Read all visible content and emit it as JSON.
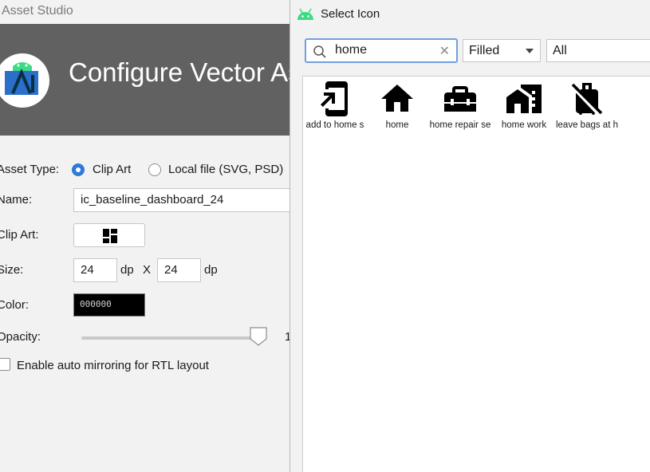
{
  "background_window": {
    "title": "Asset Studio",
    "header_title": "Configure Vector Asset",
    "asset_type_label": "Asset Type:",
    "asset_type_options": [
      "Clip Art",
      "Local file (SVG, PSD)"
    ],
    "asset_type_selected": "Clip Art",
    "name_label": "Name:",
    "name_value": "ic_baseline_dashboard_24",
    "clip_art_label": "Clip Art:",
    "clip_art_icon": "dashboard-icon",
    "size_label": "Size:",
    "width_value": "24",
    "height_value": "24",
    "unit": "dp",
    "by": "X",
    "color_label": "Color:",
    "color_value": "000000",
    "opacity_label": "Opacity:",
    "opacity_value_fraction": 1.0,
    "opacity_readout": "1",
    "mirroring_label": "Enable auto mirroring for RTL layout",
    "mirroring_checked": false
  },
  "dialog": {
    "title": "Select Icon",
    "search": {
      "value": "home",
      "clear": "✕"
    },
    "style_combo": "Filled",
    "category_combo": "All",
    "icons": [
      {
        "label": "add to home s",
        "icon": "add-to-home-screen-icon"
      },
      {
        "label": "home",
        "icon": "home-icon"
      },
      {
        "label": "home repair se",
        "icon": "home-repair-service-icon"
      },
      {
        "label": "home work",
        "icon": "home-work-icon"
      },
      {
        "label": "leave bags at h",
        "icon": "no-luggage-icon"
      }
    ]
  },
  "colors": {
    "accent": "#2f7ad8",
    "hero": "#616161",
    "android_green": "#3ddc84",
    "focus": "#6fa0e0"
  }
}
